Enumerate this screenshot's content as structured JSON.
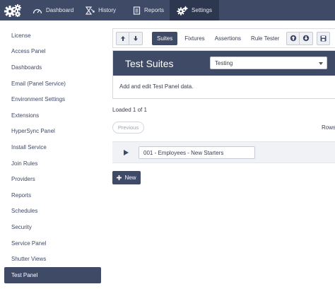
{
  "nav": {
    "items": [
      {
        "label": "Dashboard",
        "icon": "gauge-icon"
      },
      {
        "label": "History",
        "icon": "hourglass-icon"
      },
      {
        "label": "Reports",
        "icon": "report-icon"
      },
      {
        "label": "Settings",
        "icon": "gears-icon",
        "active": true
      }
    ]
  },
  "sidebar": {
    "items": [
      "License",
      "Access Panel",
      "Dashboards",
      "Email (Panel Service)",
      "Environment Settings",
      "Extensions",
      "HyperSync Panel",
      "Install Service",
      "Join Rules",
      "Providers",
      "Reports",
      "Schedules",
      "Security",
      "Service Panel",
      "Shutter Views",
      "Test Panel"
    ],
    "active": "Test Panel"
  },
  "toolbar": {
    "tabs": [
      "Suites",
      "Fixtures",
      "Assertions",
      "Rule Tester"
    ],
    "active_tab": "Suites"
  },
  "panel": {
    "title": "Test Suites",
    "select_value": "Testing",
    "description": "Add and edit Test Panel data."
  },
  "list": {
    "loaded_text": "Loaded 1 of 1",
    "previous_label": "Previous",
    "rows_label": "Rows",
    "row_value": "001 - Employees - New Starters"
  },
  "actions": {
    "new_label": "New"
  },
  "colors": {
    "nav_bg": "#3f4a66",
    "nav_active": "#2e3750",
    "accent": "#3f4a66"
  }
}
